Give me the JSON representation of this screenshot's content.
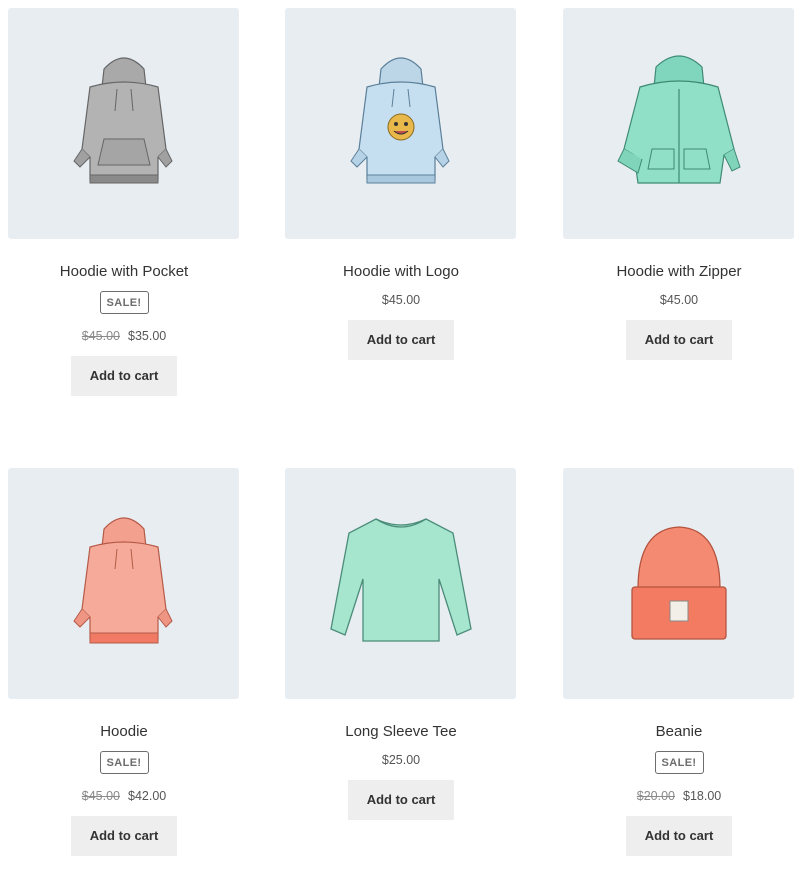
{
  "products": [
    {
      "title": "Hoodie with Pocket",
      "sale_badge": "SALE!",
      "old_price": "$45.00",
      "price": "$35.00",
      "button": "Add to cart",
      "image_icon": "gray-hoodie-icon"
    },
    {
      "title": "Hoodie with Logo",
      "price": "$45.00",
      "button": "Add to cart",
      "image_icon": "blue-hoodie-logo-icon"
    },
    {
      "title": "Hoodie with Zipper",
      "price": "$45.00",
      "button": "Add to cart",
      "image_icon": "mint-zip-hoodie-icon"
    },
    {
      "title": "Hoodie",
      "sale_badge": "SALE!",
      "old_price": "$45.00",
      "price": "$42.00",
      "button": "Add to cart",
      "image_icon": "pink-hoodie-icon"
    },
    {
      "title": "Long Sleeve Tee",
      "price": "$25.00",
      "button": "Add to cart",
      "image_icon": "mint-long-sleeve-tee-icon"
    },
    {
      "title": "Beanie",
      "sale_badge": "SALE!",
      "old_price": "$20.00",
      "price": "$18.00",
      "button": "Add to cart",
      "image_icon": "coral-beanie-icon"
    }
  ],
  "colors": {
    "image_background": "#e8edf2",
    "button_background": "#eeeeee",
    "text": "#333333"
  }
}
